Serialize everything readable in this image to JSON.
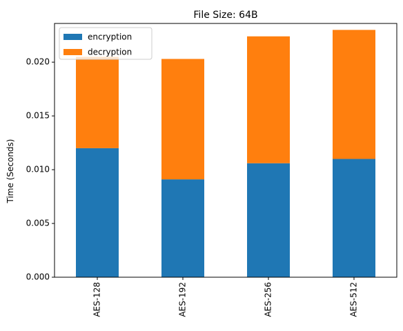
{
  "chart_data": {
    "type": "bar",
    "stacked": true,
    "title": "File Size: 64B",
    "xlabel": "",
    "ylabel": "Time (Seconds)",
    "categories": [
      "AES-128",
      "AES-192",
      "AES-256",
      "AES-512"
    ],
    "series": [
      {
        "name": "encryption",
        "color": "#1f77b4",
        "values": [
          0.012,
          0.0091,
          0.0106,
          0.011
        ]
      },
      {
        "name": "decryption",
        "color": "#ff7f0e",
        "values": [
          0.0085,
          0.0112,
          0.0118,
          0.012
        ]
      }
    ],
    "ylim": [
      0,
      0.0236
    ],
    "yticks": [
      {
        "value": 0.0,
        "label": "0.000"
      },
      {
        "value": 0.005,
        "label": "0.005"
      },
      {
        "value": 0.01,
        "label": "0.010"
      },
      {
        "value": 0.015,
        "label": "0.015"
      },
      {
        "value": 0.02,
        "label": "0.020"
      }
    ],
    "legend_position": "top-left",
    "grid": false
  }
}
